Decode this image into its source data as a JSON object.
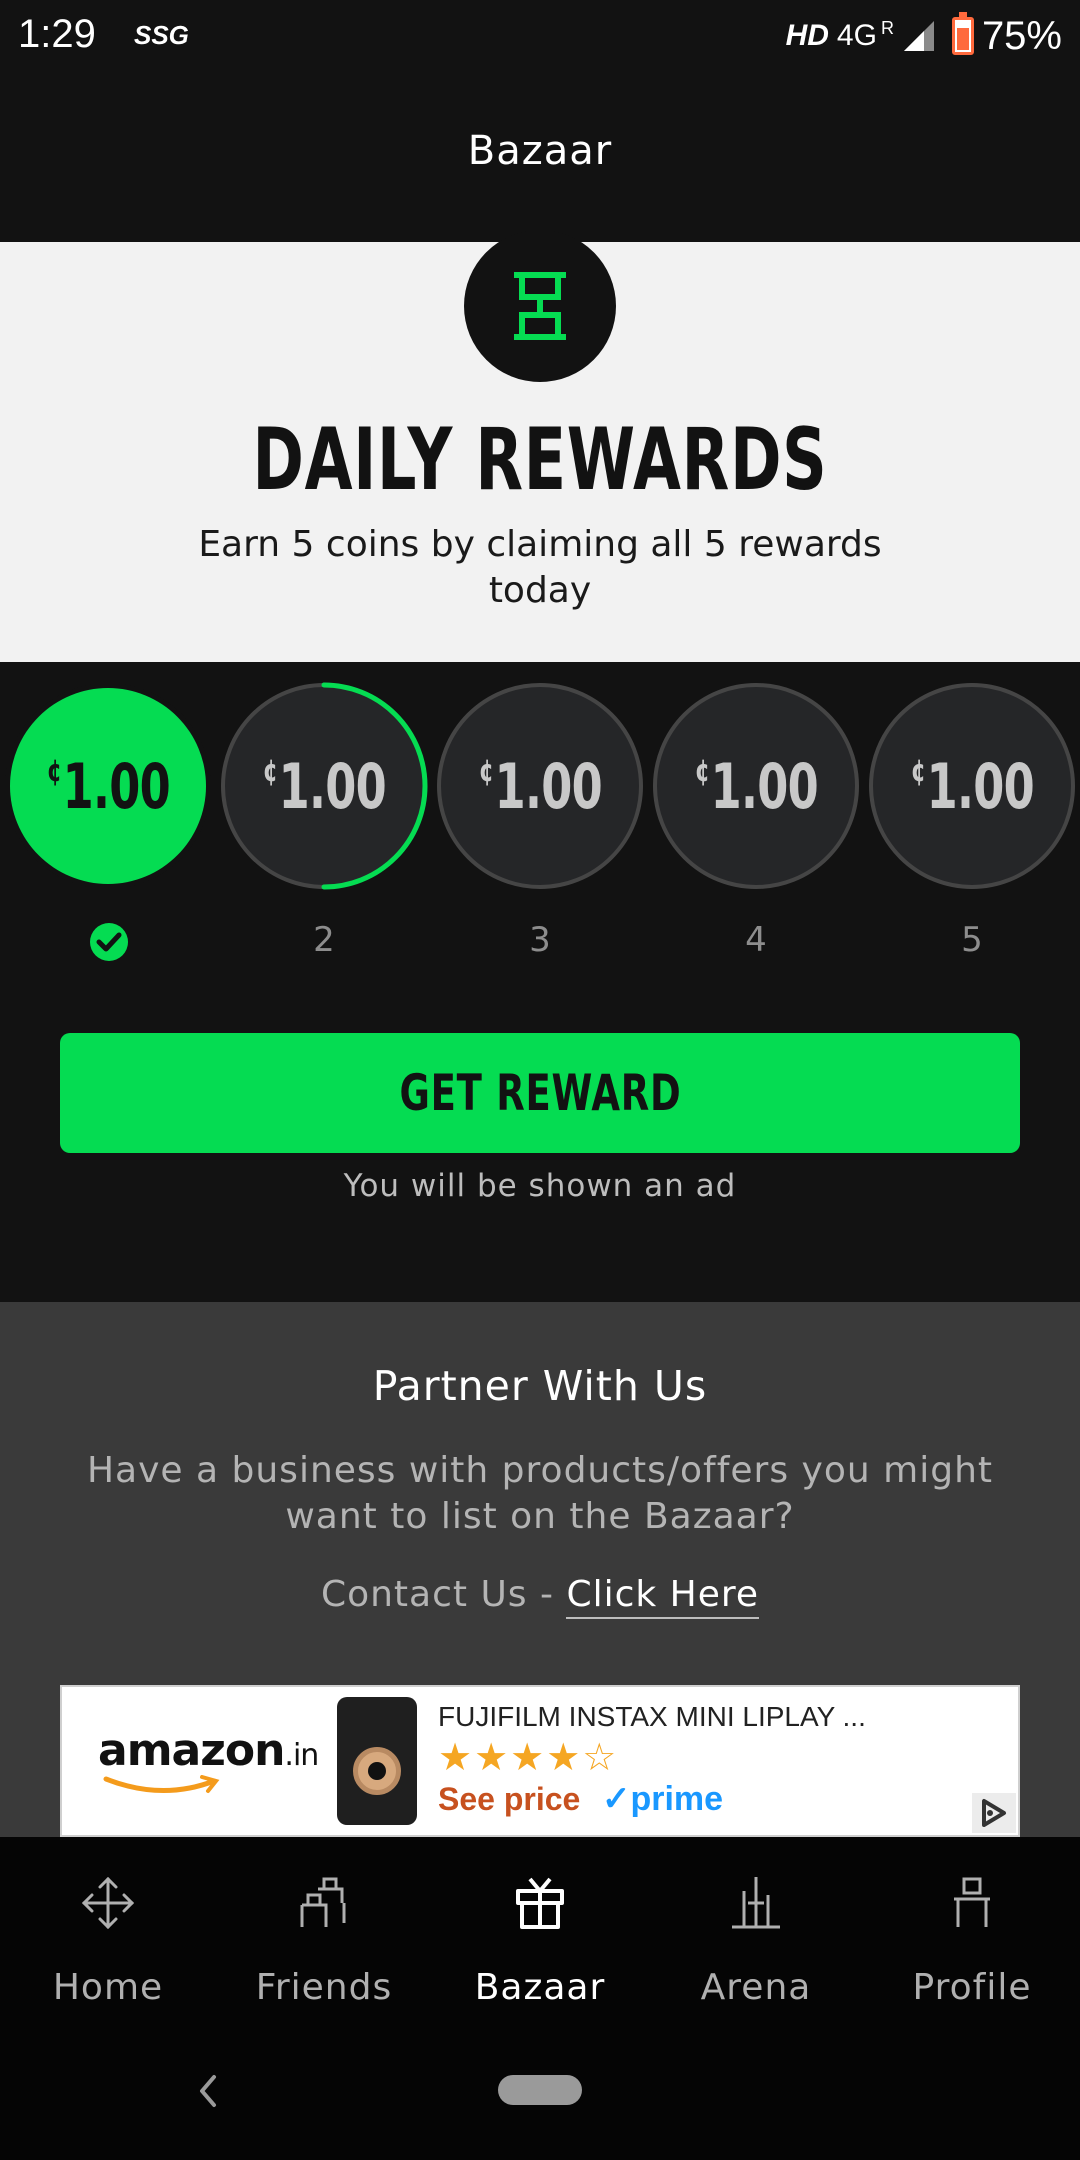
{
  "status_bar": {
    "time": "1:29",
    "carrier": "SSG",
    "hd": "HD",
    "network": "4G",
    "roaming": "R",
    "battery": "75%"
  },
  "app_bar": {
    "title": "Bazaar"
  },
  "rewards": {
    "title": "DAILY REWARDS",
    "subtitle": "Earn 5 coins by claiming all 5 rewards today",
    "currency_symbol": "¢",
    "coins": [
      {
        "value": "1.00",
        "label": "",
        "claimed": true
      },
      {
        "value": "1.00",
        "label": "2",
        "progress": 0.5
      },
      {
        "value": "1.00",
        "label": "3"
      },
      {
        "value": "1.00",
        "label": "4"
      },
      {
        "value": "1.00",
        "label": "5"
      }
    ],
    "button_label": "GET REWARD",
    "ad_note": "You will be shown an ad"
  },
  "partner": {
    "title": "Partner With Us",
    "text": "Have a business with products/offers you might want to list on the Bazaar?",
    "contact_prefix": "Contact Us - ",
    "contact_link": "Click Here"
  },
  "ad": {
    "brand": "amazon",
    "brand_tld": ".in",
    "product": "FUJIFILM INSTAX MINI LIPLAY ...",
    "stars": "★★★★",
    "stars_empty": "☆",
    "rating": 4,
    "price_label": "See price",
    "prime": "✓prime"
  },
  "nav": {
    "items": [
      {
        "label": "Home",
        "icon": "home-icon"
      },
      {
        "label": "Friends",
        "icon": "friends-icon"
      },
      {
        "label": "Bazaar",
        "icon": "gift-icon",
        "active": true
      },
      {
        "label": "Arena",
        "icon": "arena-icon"
      },
      {
        "label": "Profile",
        "icon": "profile-icon"
      }
    ]
  },
  "colors": {
    "accent": "#05dc52",
    "dark": "#121212",
    "light": "#f2f2f2",
    "partner_bg": "#3a3a3a"
  }
}
